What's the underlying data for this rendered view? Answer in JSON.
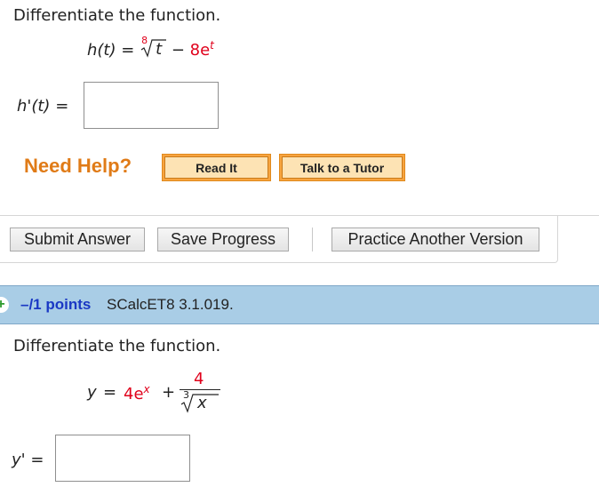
{
  "question1": {
    "prompt": "Differentiate the function.",
    "lhs": "h(t)",
    "eq": "=",
    "root_index": "8",
    "radicand": "t",
    "minus": "−",
    "coef": "8e",
    "exponent": "t",
    "answer_label": "h'(t)",
    "answer_eq": "=",
    "answer_value": ""
  },
  "help": {
    "label": "Need Help?",
    "read_it": "Read It",
    "talk_tutor": "Talk to a Tutor"
  },
  "actions": {
    "submit": "Submit Answer",
    "save": "Save Progress",
    "practice": "Practice Another Version"
  },
  "question2": {
    "points": "–/1 points",
    "id": "SCalcET8 3.1.019.",
    "prompt": "Differentiate the function.",
    "lhs": "y",
    "eq": "=",
    "term1": "4e",
    "exp1": "x",
    "plus": "+",
    "numerator": "4",
    "root_index": "3",
    "radicand": "x",
    "answer_label": "y'",
    "answer_eq": "=",
    "answer_value": ""
  },
  "colors": {
    "accent_red": "#e0001b",
    "need_help_orange": "#e07b17",
    "header_blue": "#a9cde6",
    "points_blue": "#1a38c4"
  },
  "icons": {
    "expand": "plus-icon"
  }
}
